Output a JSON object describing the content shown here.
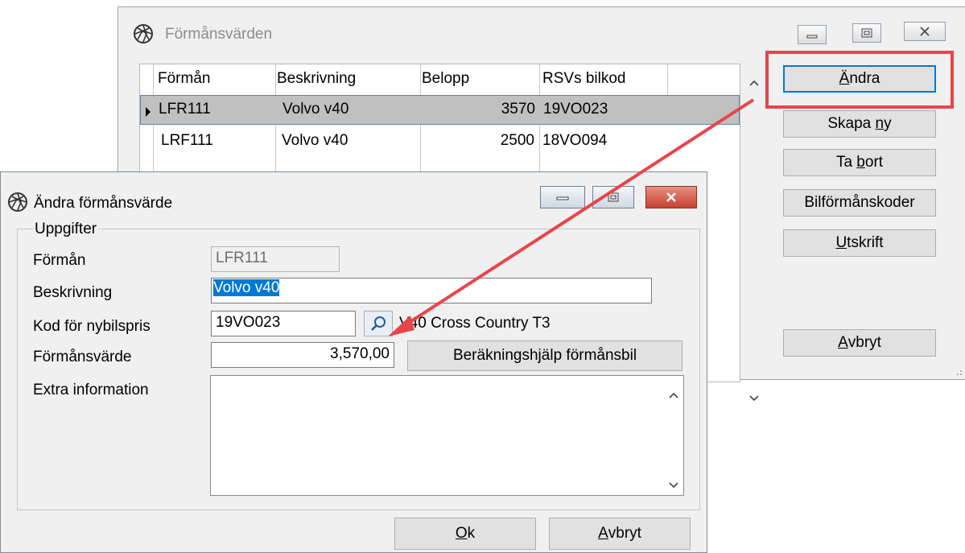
{
  "back_window": {
    "title": "Förmånsvärden",
    "columns": [
      "Förmån",
      "Beskrivning",
      "Belopp",
      "RSVs bilkod"
    ],
    "rows": [
      {
        "formansnamn": "LFR111",
        "beskrivning": "Volvo v40",
        "belopp": "3570",
        "bilkod": "19VO023"
      },
      {
        "formansnamn": "LRF111",
        "beskrivning": "Volvo v40",
        "belopp": "2500",
        "bilkod": "18VO094"
      }
    ],
    "buttons": {
      "andra": {
        "pre": "",
        "u": "Ä",
        "post": "ndra"
      },
      "skapa_ny": {
        "pre": "Skapa ",
        "u": "n",
        "post": "y"
      },
      "ta_bort": {
        "pre": "Ta ",
        "u": "b",
        "post": "ort"
      },
      "bilformanskoder": {
        "pre": "Bilförmånskoder",
        "u": "",
        "post": ""
      },
      "utskrift": {
        "pre": "",
        "u": "U",
        "post": "tskrift"
      },
      "avbryt": {
        "pre": "",
        "u": "A",
        "post": "vbryt"
      }
    }
  },
  "dialog": {
    "title": "Ändra förmånsvärde",
    "group_label": "Uppgifter",
    "labels": {
      "forman": "Förmån",
      "beskrivning": "Beskrivning",
      "kod": "Kod för nybilspris",
      "formansvarde": "Förmånsvärde",
      "extra": "Extra information"
    },
    "values": {
      "forman": "LFR111",
      "beskrivning": "Volvo v40",
      "kod": "19VO023",
      "kod_beskrivning": "V40 Cross Country T3",
      "formansvarde": "3,570,00",
      "extra": ""
    },
    "calc_button": "Beräkningshjälp förmånsbil",
    "ok": {
      "pre": "",
      "u": "O",
      "post": "k"
    },
    "cancel": {
      "pre": "",
      "u": "A",
      "post": "vbryt"
    }
  },
  "colors": {
    "callout": "#e8454a",
    "selection": "#0078d7",
    "row_selected": "#c0c0c0"
  }
}
